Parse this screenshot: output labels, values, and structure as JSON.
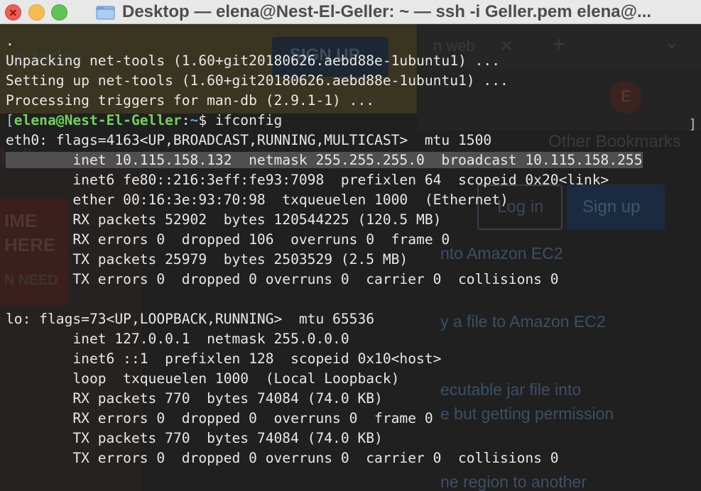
{
  "window": {
    "title": "Desktop — elena@Nest-El-Geller: ~ — ssh -i Geller.pem elena@..."
  },
  "background_window": {
    "top_left_text": "p today",
    "signup_top": "SIGN UP",
    "ads_label": "LADS",
    "tab_fragment": "n web",
    "tab_close": "✕",
    "new_tab": "+",
    "chevron": "⌄",
    "avatar_letter": "E",
    "bookmarks": "Other Bookmarks",
    "login": "Log in",
    "signup": "Sign up",
    "left_fragment": "keller",
    "banner_lines": [
      "IME",
      "HERE",
      "N NEED"
    ],
    "links": [
      "nto Amazon EC2",
      "y a file to Amazon EC2",
      "ecutable jar file into",
      "e but getting permission",
      "ne region to another"
    ]
  },
  "terminal": {
    "lines": [
      ".",
      "Unpacking net-tools (1.60+git20180626.aebd88e-1ubuntu1) ...",
      "Setting up net-tools (1.60+git20180626.aebd88e-1ubuntu1) ...",
      "Processing triggers for man-db (2.9.1-1) ..."
    ],
    "prompt": {
      "open_bracket": "[",
      "user_host": "elena@Nest-El-Geller",
      "colon": ":",
      "path": "~",
      "symbol": "$",
      "command": " ifconfig"
    },
    "close_bracket": "]",
    "output": [
      "eth0: flags=4163<UP,BROADCAST,RUNNING,MULTICAST>  mtu 1500",
      "        inet 10.115.158.132  netmask 255.255.255.0  broadcast 10.115.158.255",
      "        inet6 fe80::216:3eff:fe93:7098  prefixlen 64  scopeid 0x20<link>",
      "        ether 00:16:3e:93:70:98  txqueuelen 1000  (Ethernet)",
      "        RX packets 52902  bytes 120544225 (120.5 MB)",
      "        RX errors 0  dropped 106  overruns 0  frame 0",
      "        TX packets 25979  bytes 2503529 (2.5 MB)",
      "        TX errors 0  dropped 0 overruns 0  carrier 0  collisions 0",
      "",
      "lo: flags=73<UP,LOOPBACK,RUNNING>  mtu 65536",
      "        inet 127.0.0.1  netmask 255.0.0.0",
      "        inet6 ::1  prefixlen 128  scopeid 0x10<host>",
      "        loop  txqueuelen 1000  (Local Loopback)",
      "        RX packets 770  bytes 74084 (74.0 KB)",
      "        RX errors 0  dropped 0  overruns 0  frame 0",
      "        TX packets 770  bytes 74084 (74.0 KB)",
      "        TX errors 0  dropped 0 overruns 0  carrier 0  collisions 0"
    ],
    "colors": {
      "background": "#202020",
      "text": "#e8e8e8",
      "prompt_user": "#6fd35a",
      "prompt_path": "#6c9cef",
      "selection": "#4f4f4f"
    }
  }
}
